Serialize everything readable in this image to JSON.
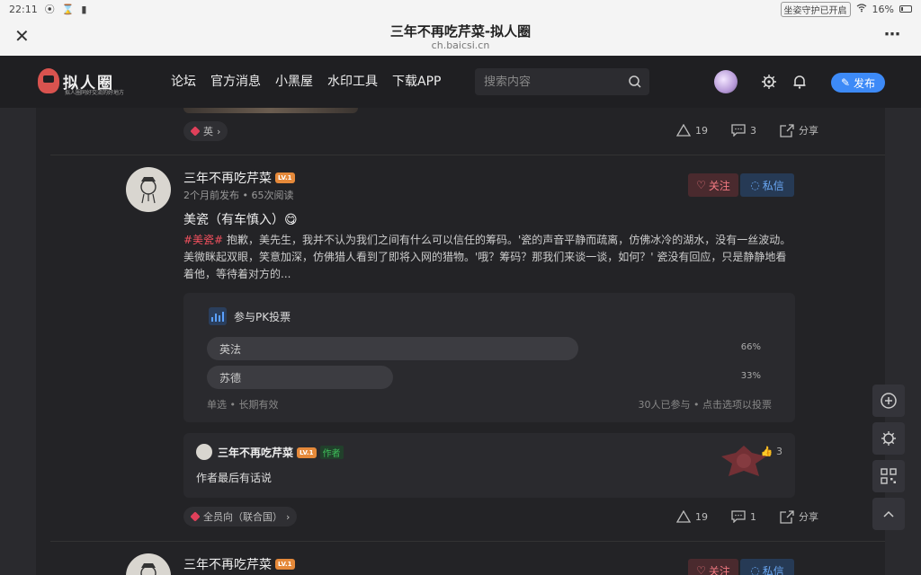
{
  "status": {
    "time": "22:11",
    "guard_label": "坐姿守护已开启",
    "battery": "16%"
  },
  "browser": {
    "title": "三年不再吃芹菜-拟人圈",
    "domain": "ch.baicsi.cn"
  },
  "site": {
    "logo_text": "拟人圈",
    "logo_sub": "拟人圈同好交流的好地方",
    "nav": [
      "论坛",
      "官方消息",
      "小黑屋",
      "水印工具",
      "下载APP"
    ],
    "search_placeholder": "搜索内容",
    "publish_label": "发布"
  },
  "prev_post": {
    "tag": "英",
    "likes": "19",
    "comments": "3",
    "share": "分享"
  },
  "post": {
    "author": "三年不再吃芹菜",
    "level": "LV.1",
    "meta": "2个月前发布 • 65次阅读",
    "follow": "关注",
    "message": "私信",
    "title": "美瓷（有车慎入）😋",
    "hashtag": "#美瓷#",
    "body": " 抱歉，美先生，我并不认为我们之间有什么可以信任的筹码。'瓷的声音平静而疏离，仿佛冰冷的湖水，没有一丝波动。 美微眯起双眼，笑意加深，仿佛猎人看到了即将入网的猎物。'哦？筹码？那我们来谈一谈，如何？' 瓷没有回应，只是静静地看着他，等待着对方的...",
    "pk": {
      "title": "参与PK投票",
      "options": [
        {
          "label": "英法",
          "pct": "66%",
          "value": 0.66
        },
        {
          "label": "苏德",
          "pct": "33%",
          "value": 0.33
        }
      ],
      "foot_left": "单选 • 长期有效",
      "foot_right": "30人已参与 • 点击选项以投票"
    },
    "author_box": {
      "name": "三年不再吃芹菜",
      "author_tag": "作者",
      "text": "作者最后有话说",
      "likes": "3"
    },
    "tag": "全员向（联合国）",
    "likes": "19",
    "comments": "1",
    "share": "分享"
  },
  "next_post": {
    "author": "三年不再吃芹菜",
    "level": "LV.1",
    "follow": "关注",
    "message": "私信"
  }
}
